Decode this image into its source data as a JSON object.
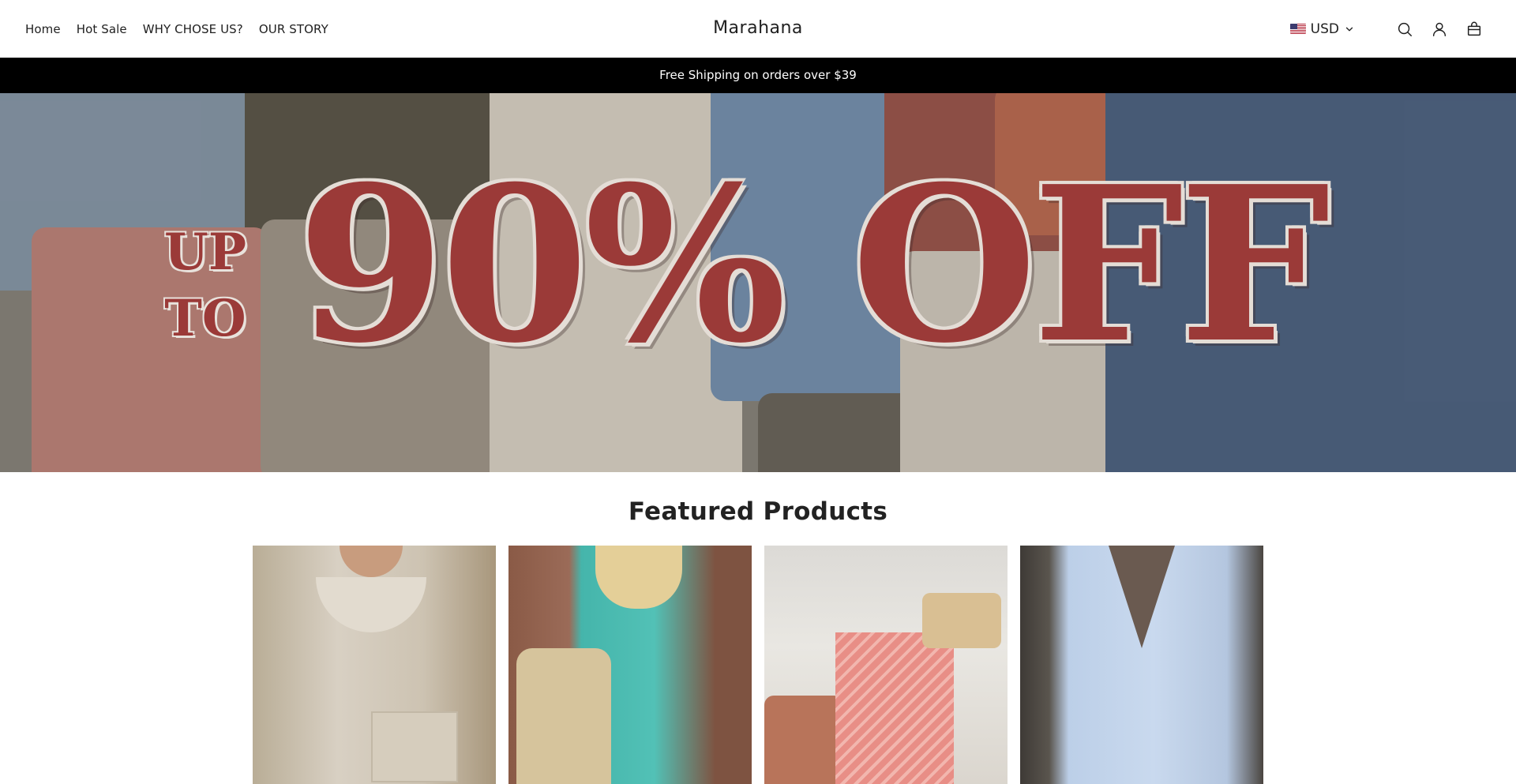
{
  "header": {
    "nav": [
      {
        "label": "Home"
      },
      {
        "label": "Hot Sale"
      },
      {
        "label": "WHY CHOSE US?"
      },
      {
        "label": "OUR STORY"
      }
    ],
    "brand": "Marahana",
    "currency": "USD",
    "icons": [
      "us-flag-icon",
      "chevron-down-icon",
      "search-icon",
      "account-icon",
      "cart-icon"
    ]
  },
  "announcement": "Free Shipping on orders over $39",
  "hero": {
    "promo_small_line1": "UP",
    "promo_small_line2": "TO",
    "promo_big": "90% OFF",
    "accent_color": "#9b3a38"
  },
  "featured": {
    "title": "Featured Products"
  }
}
